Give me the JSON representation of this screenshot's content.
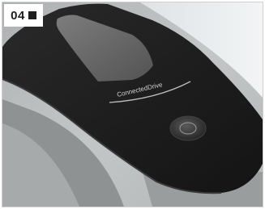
{
  "badge": {
    "number": "04"
  },
  "photo": {
    "module_label": "ConnectedDrive"
  },
  "colors": {
    "module_body": "#1f1f1f",
    "headliner": "#b9bcbd",
    "window_glass": "#e8ecef"
  }
}
